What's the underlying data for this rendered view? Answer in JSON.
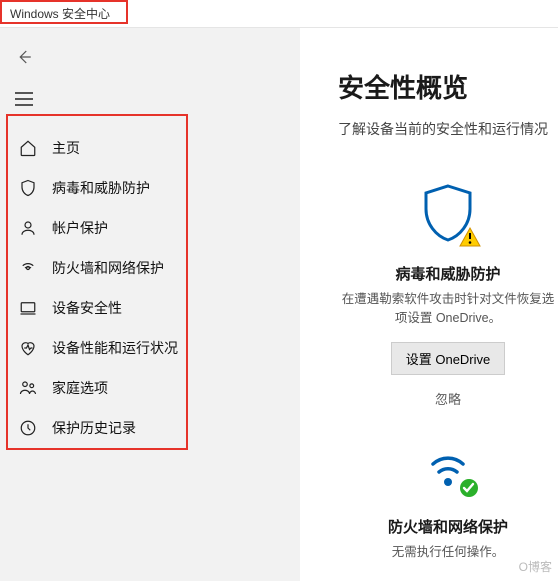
{
  "window": {
    "title": "Windows 安全中心"
  },
  "sidebar": {
    "items": [
      {
        "label": "主页"
      },
      {
        "label": "病毒和威胁防护"
      },
      {
        "label": "帐户保护"
      },
      {
        "label": "防火墙和网络保护"
      },
      {
        "label": "设备安全性"
      },
      {
        "label": "设备性能和运行状况"
      },
      {
        "label": "家庭选项"
      },
      {
        "label": "保护历史记录"
      }
    ]
  },
  "main": {
    "heading": "安全性概览",
    "subtitle": "了解设备当前的安全性和运行情况",
    "cards": [
      {
        "title": "病毒和威胁防护",
        "desc": "在遭遇勒索软件攻击时针对文件恢复选项设置 OneDrive。",
        "button": "设置 OneDrive",
        "dismiss": "忽略",
        "status": "warning"
      },
      {
        "title": "防火墙和网络保护",
        "desc": "无需执行任何操作。",
        "status": "ok"
      }
    ]
  },
  "watermark": "O博客"
}
